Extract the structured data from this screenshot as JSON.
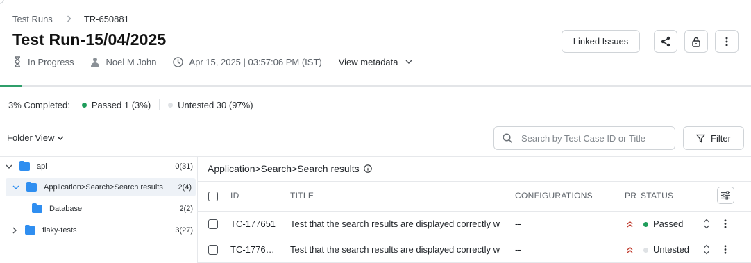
{
  "breadcrumb": {
    "parent": "Test Runs",
    "current": "TR-650881"
  },
  "title": "Test Run-15/04/2025",
  "meta": {
    "status": "In Progress",
    "assignee": "Noel M John",
    "date": "Apr 15, 2025 | 03:57:06 PM (IST)",
    "view_metadata": "View metadata"
  },
  "header_buttons": {
    "linked_issues": "Linked Issues"
  },
  "progress": {
    "completed_fraction": 0.03
  },
  "summary": {
    "completed": "3% Completed:",
    "passed": "Passed 1 (3%)",
    "untested": "Untested 30 (97%)"
  },
  "folder_view": "Folder View",
  "search": {
    "placeholder": "Search by Test Case ID or Title"
  },
  "filter_label": "Filter",
  "tree": [
    {
      "name": "api",
      "count": "0(31)"
    },
    {
      "name": "Application>Search>Search results",
      "count": "2(4)"
    },
    {
      "name": "Database",
      "count": "2(2)"
    },
    {
      "name": "flaky-tests",
      "count": "3(27)"
    }
  ],
  "panel_title": "Application>Search>Search results",
  "table": {
    "columns": {
      "id": "ID",
      "title": "TITLE",
      "configurations": "CONFIGURATIONS",
      "priority": "PR",
      "status": "STATUS"
    },
    "rows": [
      {
        "id": "TC-177651",
        "title": "Test that the search results are displayed correctly w",
        "config": "--",
        "status": "Passed"
      },
      {
        "id": "TC-1776…",
        "title": "Test that the search results are displayed correctly w",
        "config": "--",
        "status": "Untested"
      }
    ]
  },
  "colors": {
    "passed": "#1f9d5b",
    "untested": "#dfe2e5",
    "folder": "#2f8ef0",
    "priority": "#c0392b",
    "progress": "#2f9e6a"
  }
}
